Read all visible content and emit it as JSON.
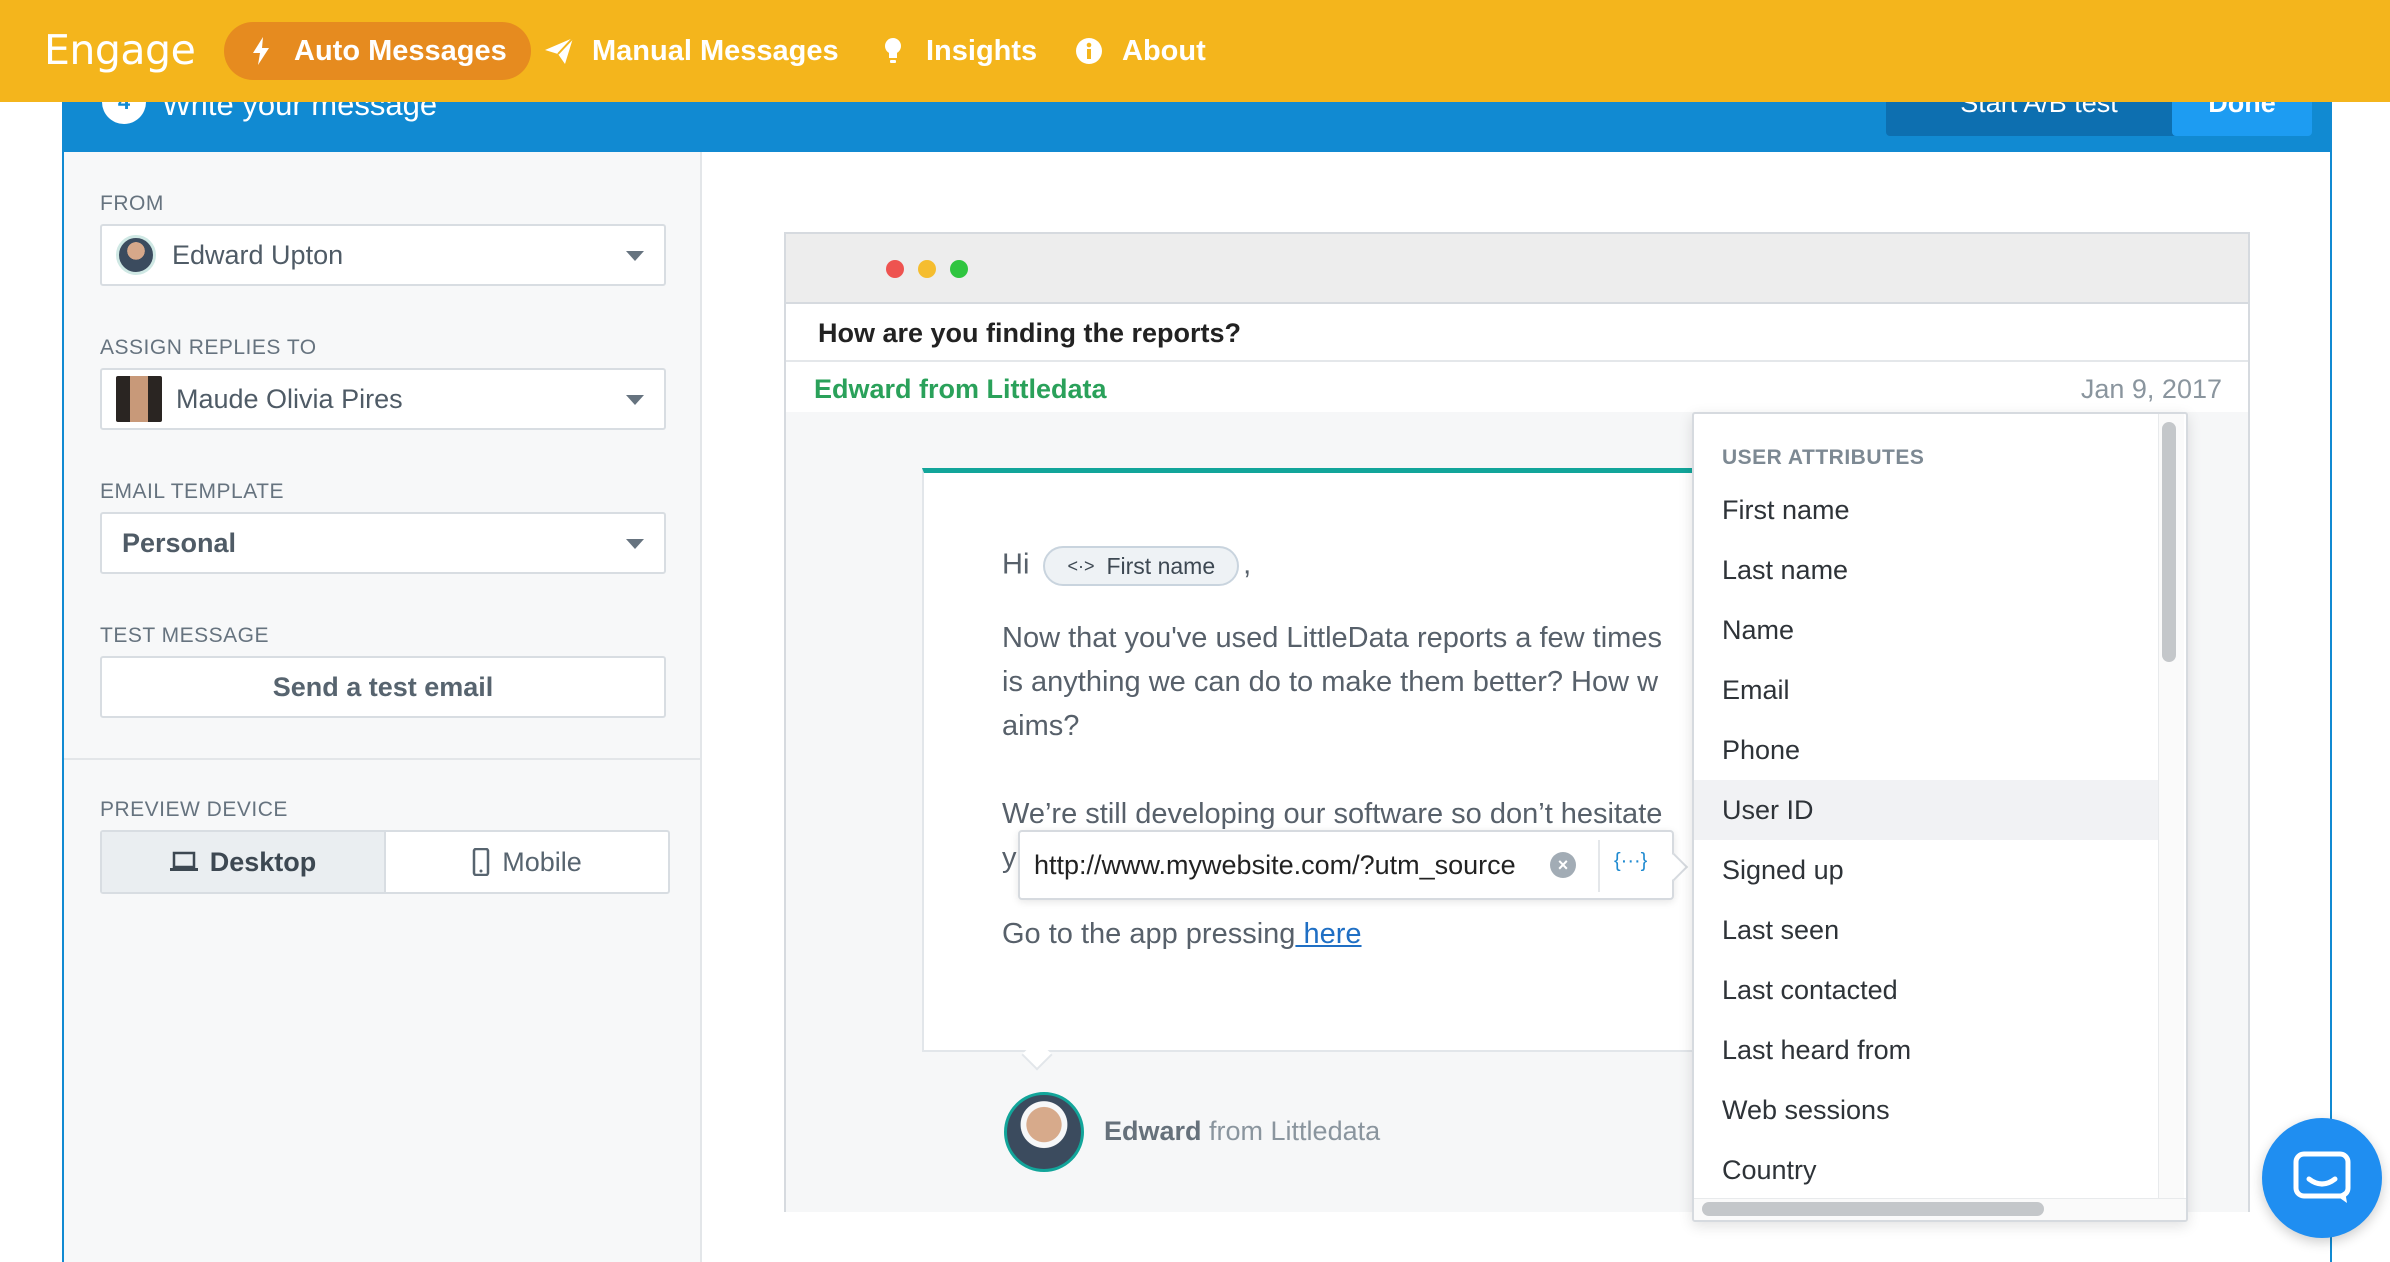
{
  "nav": {
    "brand": "Engage",
    "items": [
      {
        "label": "Auto Messages",
        "icon": "bolt-icon",
        "active": true
      },
      {
        "label": "Manual Messages",
        "icon": "paper-plane-icon",
        "active": false
      },
      {
        "label": "Insights",
        "icon": "lightbulb-icon",
        "active": false
      },
      {
        "label": "About",
        "icon": "info-icon",
        "active": false
      }
    ]
  },
  "step": {
    "number": "4",
    "title": "Write your message",
    "ab_label": "Start A/B test",
    "done_label": "Done"
  },
  "sidebar": {
    "from_label": "FROM",
    "from_value": "Edward Upton",
    "assign_label": "ASSIGN REPLIES TO",
    "assign_value": "Maude Olivia Pires",
    "template_label": "EMAIL TEMPLATE",
    "template_value": "Personal",
    "test_label": "TEST MESSAGE",
    "test_button": "Send a test email",
    "device_label": "PREVIEW DEVICE",
    "device_desktop": "Desktop",
    "device_mobile": "Mobile",
    "device_selected": "Desktop"
  },
  "preview": {
    "subject": "How are you finding the reports?",
    "sender": "Edward from Littledata",
    "date": "Jan 9, 2017",
    "greeting": "Hi",
    "chip_label": "First name",
    "greeting_end": ",",
    "para1_line1": "Now that you've used LittleData reports a few times",
    "para1_line2": "is anything we can do to make them better? How w",
    "para1_line3": "aims?",
    "para2_line1": "We’re still developing our software so don’t hesitate",
    "para2_line2_start": "y",
    "cta_text": "Go to the app pressing",
    "cta_link": " here",
    "url_value": "http://www.mywebsite.com/?utm_source",
    "url_var_symbol": "{···}",
    "footer_name": "Edward",
    "footer_from": " from Littledata"
  },
  "attributes": {
    "heading": "USER ATTRIBUTES",
    "items": [
      "First name",
      "Last name",
      "Name",
      "Email",
      "Phone",
      "User ID",
      "Signed up",
      "Last seen",
      "Last contacted",
      "Last heard from",
      "Web sessions",
      "Country"
    ],
    "hovered": "User ID"
  },
  "colors": {
    "nav_bg": "#f4b51c",
    "nav_active": "#e68b1f",
    "step_blue": "#118ad2",
    "sender_green": "#2aa15a",
    "accent_teal": "#12a59a",
    "link_blue": "#1f6fc4"
  }
}
